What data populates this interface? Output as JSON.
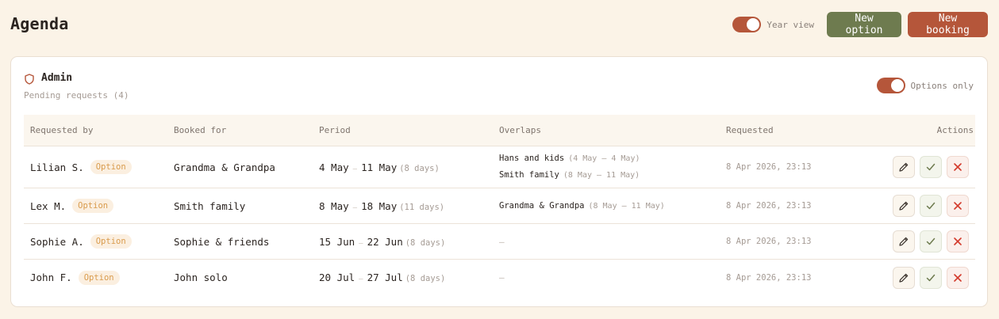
{
  "page": {
    "title": "Agenda"
  },
  "topbar": {
    "year_view_label": "Year view",
    "year_view_on": true,
    "new_option_label": "New option",
    "new_booking_label": "New booking"
  },
  "admin": {
    "title": "Admin",
    "pending": "Pending requests (4)",
    "options_only_label": "Options only",
    "options_only_on": true
  },
  "table": {
    "headers": {
      "requested_by": "Requested by",
      "booked_for": "Booked for",
      "period": "Period",
      "overlaps": "Overlaps",
      "requested": "Requested",
      "actions": "Actions"
    },
    "rows": [
      {
        "name": "Lilian S.",
        "badge": "Option",
        "booked_for": "Grandma & Grandpa",
        "start": "4 May",
        "end": "11 May",
        "days": "(8 days)",
        "overlaps": [
          {
            "name": "Hans and kids",
            "range": "(4 May – 4 May)"
          },
          {
            "name": "Smith family",
            "range": "(8 May – 11 May)"
          }
        ],
        "requested": "8 Apr 2026, 23:13"
      },
      {
        "name": "Lex M.",
        "badge": "Option",
        "booked_for": "Smith family",
        "start": "8 May",
        "end": "18 May",
        "days": "(11 days)",
        "overlaps": [
          {
            "name": "Grandma & Grandpa",
            "range": "(8 May – 11 May)"
          }
        ],
        "requested": "8 Apr 2026, 23:13"
      },
      {
        "name": "Sophie A.",
        "badge": "Option",
        "booked_for": "Sophie & friends",
        "start": "15 Jun",
        "end": "22 Jun",
        "days": "(8 days)",
        "overlaps": [],
        "overlaps_empty": "–",
        "requested": "8 Apr 2026, 23:13"
      },
      {
        "name": "John F.",
        "badge": "Option",
        "booked_for": "John solo",
        "start": "20 Jul",
        "end": "27 Jul",
        "days": "(8 days)",
        "overlaps": [],
        "overlaps_empty": "–",
        "requested": "8 Apr 2026, 23:13"
      }
    ],
    "range_dash": "–"
  },
  "colors": {
    "background": "#fbf3e7",
    "accent": "#b5563a",
    "olive": "#6e7b4f",
    "badge_text": "#d99b4c"
  },
  "icons": [
    "shield-icon",
    "edit-icon",
    "check-icon",
    "close-icon"
  ]
}
